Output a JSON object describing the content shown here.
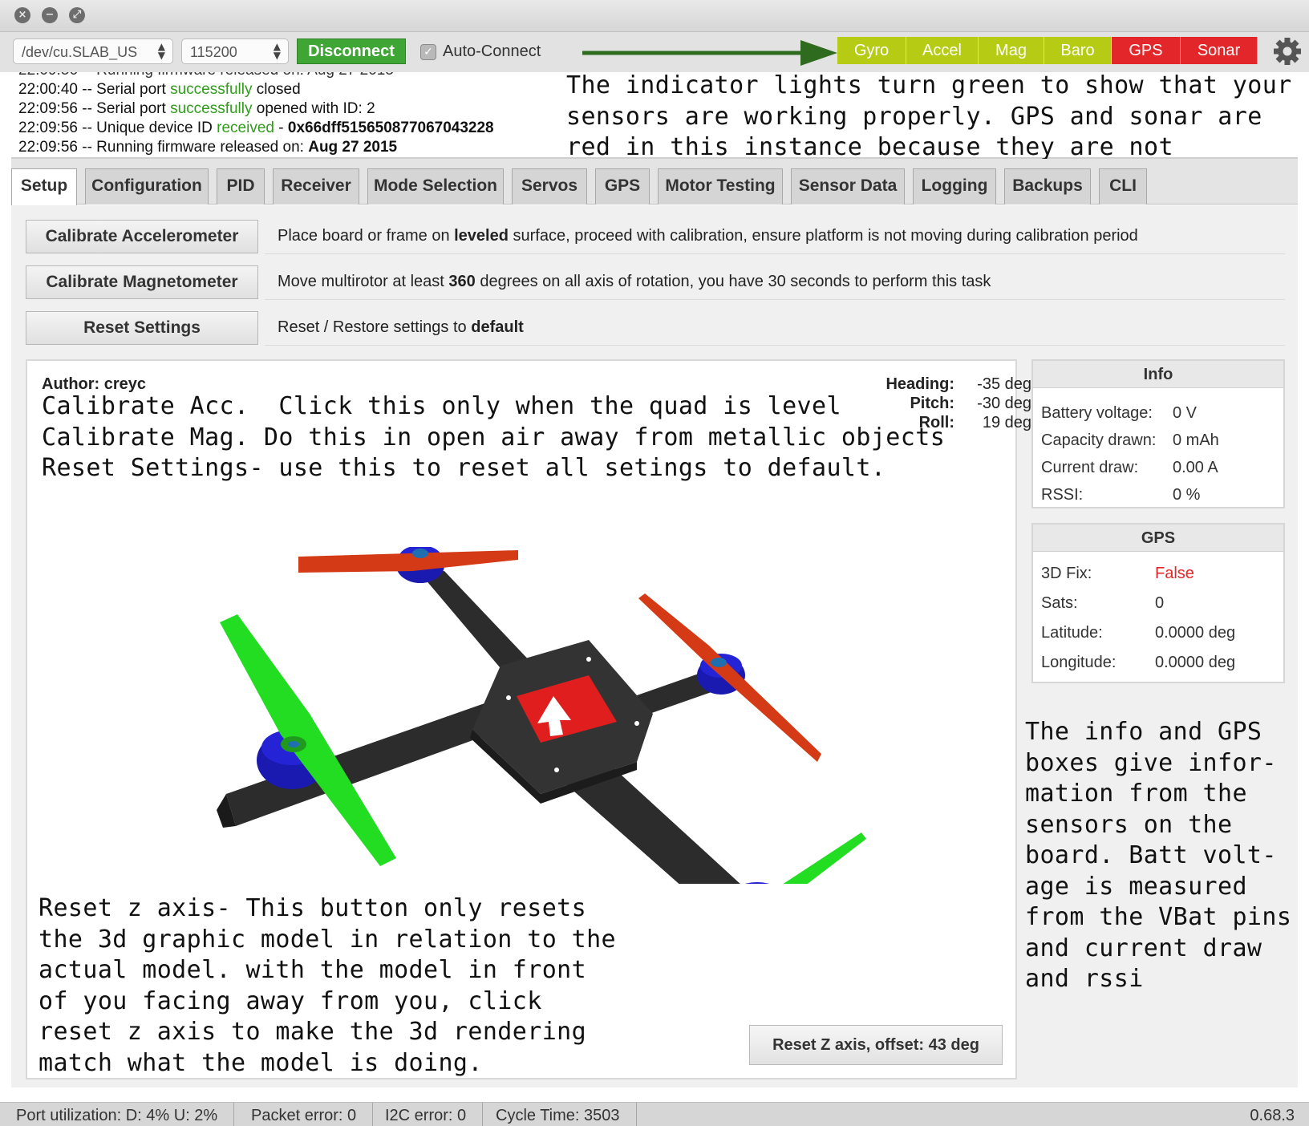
{
  "window": {
    "buttons": [
      "close-icon",
      "minimize-icon",
      "fullscreen-icon"
    ]
  },
  "toolbar": {
    "port": "/dev/cu.SLAB_US",
    "baud": "115200",
    "disconnect_label": "Disconnect",
    "auto_connect_label": "Auto-Connect",
    "auto_connect_checked": true,
    "sensors": [
      {
        "label": "Gyro",
        "status": "ok",
        "color": "#b6cc14"
      },
      {
        "label": "Accel",
        "status": "ok",
        "color": "#b6cc14"
      },
      {
        "label": "Mag",
        "status": "ok",
        "color": "#b6cc14"
      },
      {
        "label": "Baro",
        "status": "ok",
        "color": "#b6cc14"
      },
      {
        "label": "GPS",
        "status": "off",
        "color": "#e3262a"
      },
      {
        "label": "Sonar",
        "status": "off",
        "color": "#e3262a"
      }
    ],
    "settings_icon": "gear-icon"
  },
  "log": {
    "lines": [
      {
        "time": "22:00:40",
        "pre": " -- Serial port ",
        "highlight": "successfully",
        "post": " closed",
        "bold": ""
      },
      {
        "time": "22:09:56",
        "pre": " -- Serial port ",
        "highlight": "successfully",
        "post": " opened with ID: 2",
        "bold": ""
      },
      {
        "time": "22:09:56",
        "pre": " -- Unique device ID ",
        "highlight": "received",
        "post": " - ",
        "bold": "0x66dff515650877067043228"
      },
      {
        "time": "22:09:56",
        "pre": " -- Running firmware released on: ",
        "highlight": "",
        "post": "",
        "bold": "Aug 27 2015"
      }
    ]
  },
  "annotations": {
    "top": "The indicator lights turn green to show that your sensors are working properly.  GPS and sonar are red in this instance because they are not enabled.",
    "middle": "Calibrate Acc.  Click this only when the quad is level\nCalibrate Mag. Do this in open air away from metallic objects\nReset Settings- use this to reset all setings to default.",
    "bottom": "Reset z axis- This button only resets the 3d graphic model in relation to the actual model.  with the model in front of you facing away from you, click reset z axis to make the 3d rendering match what the model is doing.",
    "right": "The info and GPS boxes give infor-mation from the sensors on the board.  Batt volt-age is measured from the VBat pins and current draw and rssi"
  },
  "tabs": [
    {
      "label": "Setup",
      "active": true
    },
    {
      "label": "Configuration",
      "active": false
    },
    {
      "label": "PID",
      "active": false
    },
    {
      "label": "Receiver",
      "active": false
    },
    {
      "label": "Mode Selection",
      "active": false
    },
    {
      "label": "Servos",
      "active": false
    },
    {
      "label": "GPS",
      "active": false
    },
    {
      "label": "Motor Testing",
      "active": false
    },
    {
      "label": "Sensor Data",
      "active": false
    },
    {
      "label": "Logging",
      "active": false
    },
    {
      "label": "Backups",
      "active": false
    },
    {
      "label": "CLI",
      "active": false
    }
  ],
  "setup": {
    "calibrate_acc": {
      "label": "Calibrate Accelerometer",
      "text_pre": "Place board or frame on ",
      "text_bold": "leveled",
      "text_post": " surface, proceed with calibration, ensure platform is not moving during calibration period"
    },
    "calibrate_mag": {
      "label": "Calibrate Magnetometer",
      "text_pre": "Move multirotor at least ",
      "text_bold": "360",
      "text_post": " degrees on all axis of rotation, you have 30 seconds to perform this task"
    },
    "reset_settings": {
      "label": "Reset Settings",
      "text_pre": "Reset / Restore settings to ",
      "text_bold": "default",
      "text_post": ""
    }
  },
  "model": {
    "author": "Author: creyc",
    "heading_label": "Heading:",
    "heading_value": "-35 deg",
    "pitch_label": "Pitch:",
    "pitch_value": "-30 deg",
    "roll_label": "Roll:",
    "roll_value": "19 deg",
    "reset_z_label": "Reset Z axis, offset: 43 deg"
  },
  "info": {
    "title": "Info",
    "rows": [
      {
        "label": "Battery voltage:",
        "value": "0 V"
      },
      {
        "label": "Capacity drawn:",
        "value": "0 mAh"
      },
      {
        "label": "Current draw:",
        "value": "0.00 A"
      },
      {
        "label": "RSSI:",
        "value": "0 %"
      }
    ]
  },
  "gps": {
    "title": "GPS",
    "rows": [
      {
        "label": "3D Fix:",
        "value": "False",
        "alert": true
      },
      {
        "label": "Sats:",
        "value": "0",
        "alert": false
      },
      {
        "label": "Latitude:",
        "value": "0.0000 deg",
        "alert": false
      },
      {
        "label": "Longitude:",
        "value": "0.0000 deg",
        "alert": false
      }
    ]
  },
  "status": {
    "port_utilization": "Port utilization: D: 4% U: 2%",
    "packet_error": "Packet error: 0",
    "i2c_error": "I2C error: 0",
    "cycle_time": "Cycle Time: 3503",
    "version": "0.68.3"
  },
  "colors": {
    "ok": "#b6cc14",
    "off": "#e3262a",
    "connect": "#3fa535",
    "success_text": "#2f9d1a",
    "arrow": "#2e6b1e"
  }
}
